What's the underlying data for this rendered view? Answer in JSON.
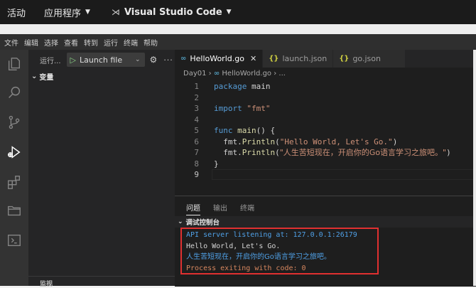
{
  "topbar": {
    "activities": "活动",
    "apps": "应用程序",
    "window_title": "Visual Studio Code"
  },
  "menu": [
    "文件",
    "编辑",
    "选择",
    "查看",
    "转到",
    "运行",
    "终端",
    "帮助"
  ],
  "activity_bar": [
    "explorer-icon",
    "search-icon",
    "source-control-icon",
    "run-debug-icon",
    "extensions-icon",
    "folder-icon",
    "terminal-icon"
  ],
  "sidebar": {
    "run_label": "运行...",
    "launch_config": "Launch file",
    "variables": "变量",
    "bottom_section": "监视"
  },
  "tabs": [
    {
      "label": "HelloWorld.go",
      "icon": "go-icon",
      "active": true
    },
    {
      "label": "launch.json",
      "icon": "json-icon",
      "active": false
    },
    {
      "label": "go.json",
      "icon": "json-icon",
      "active": false
    }
  ],
  "breadcrumb": {
    "folder": "Day01",
    "file": "HelloWorld.go",
    "rest": "..."
  },
  "code_lines": [
    {
      "num": "1",
      "text": "package main"
    },
    {
      "num": "2",
      "text": ""
    },
    {
      "num": "3",
      "text": "import \"fmt\""
    },
    {
      "num": "4",
      "text": ""
    },
    {
      "num": "5",
      "text": "func main() {"
    },
    {
      "num": "6",
      "text": "  fmt.Println(\"Hello World, Let's Go.\")"
    },
    {
      "num": "7",
      "text": "  fmt.Println(\"人生苦短现在，开启你的Go语言学习之旅吧。\")"
    },
    {
      "num": "8",
      "text": "}"
    },
    {
      "num": "9",
      "text": ""
    }
  ],
  "panel": {
    "tabs": [
      "问题",
      "输出",
      "终端"
    ],
    "section": "调试控制台",
    "console": [
      "API server listening at: 127.0.0.1:26179",
      "Hello World, Let's Go.",
      "人生苦短现在，开启你的Go语言学习之旅吧。",
      "Process exiting with code: 0"
    ]
  }
}
